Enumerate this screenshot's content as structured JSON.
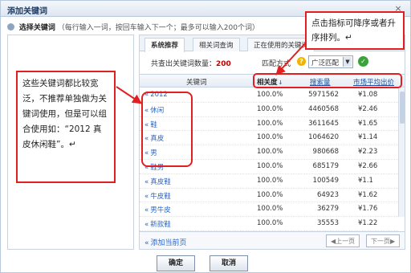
{
  "window": {
    "title": "添加关键词",
    "close_glyph": "×"
  },
  "hint": {
    "strong": "选择关键词",
    "note": "（每行输入一词，按回车输入下一个；最多可以输入200个词）"
  },
  "tabs": [
    {
      "label": "系统推荐",
      "active": true
    },
    {
      "label": "相关词查询",
      "active": false
    },
    {
      "label": "正在使用的关键词",
      "active": false
    }
  ],
  "info": {
    "count_label": "共查出关键词数量：",
    "count_value": "200",
    "match_label": "匹配方式",
    "help_glyph": "?",
    "match_value": "广泛匹配",
    "select_arrow": "▼",
    "go_glyph": "✓"
  },
  "table": {
    "headers": {
      "keyword": "关键词",
      "relevance": "相关度",
      "relevance_sort": "↓",
      "search": "搜索量",
      "price": "市场平均出价"
    },
    "add_glyph": "«",
    "rows": [
      {
        "keyword": "2012",
        "relevance": "100.0%",
        "search": "5971562",
        "price": "¥1.08"
      },
      {
        "keyword": "休闲",
        "relevance": "100.0%",
        "search": "4460568",
        "price": "¥2.46"
      },
      {
        "keyword": "鞋",
        "relevance": "100.0%",
        "search": "3611645",
        "price": "¥1.65"
      },
      {
        "keyword": "真皮",
        "relevance": "100.0%",
        "search": "1064620",
        "price": "¥1.14"
      },
      {
        "keyword": "男",
        "relevance": "100.0%",
        "search": "980668",
        "price": "¥2.23"
      },
      {
        "keyword": "鞋男",
        "relevance": "100.0%",
        "search": "685179",
        "price": "¥2.66"
      },
      {
        "keyword": "真皮鞋",
        "relevance": "100.0%",
        "search": "100549",
        "price": "¥1.1"
      },
      {
        "keyword": "牛皮鞋",
        "relevance": "100.0%",
        "search": "64923",
        "price": "¥1.62"
      },
      {
        "keyword": "男牛皮",
        "relevance": "100.0%",
        "search": "36279",
        "price": "¥1.76"
      },
      {
        "keyword": "新款鞋",
        "relevance": "100.0%",
        "search": "35553",
        "price": "¥1.22"
      }
    ]
  },
  "footer": {
    "add_page": "添加当前页",
    "prev": "◀上一页",
    "next": "下一页▶"
  },
  "buttons": {
    "ok": "确定",
    "cancel": "取消"
  },
  "annotations": {
    "left_note": "这些关键词都比较宽泛，不推荐单独做为关键词使用，但是可以组合使用如：“2012 真皮休闲鞋”。↵",
    "right_note": "点击指标可降序或者升序排列。↵",
    "color": "#e02020"
  }
}
